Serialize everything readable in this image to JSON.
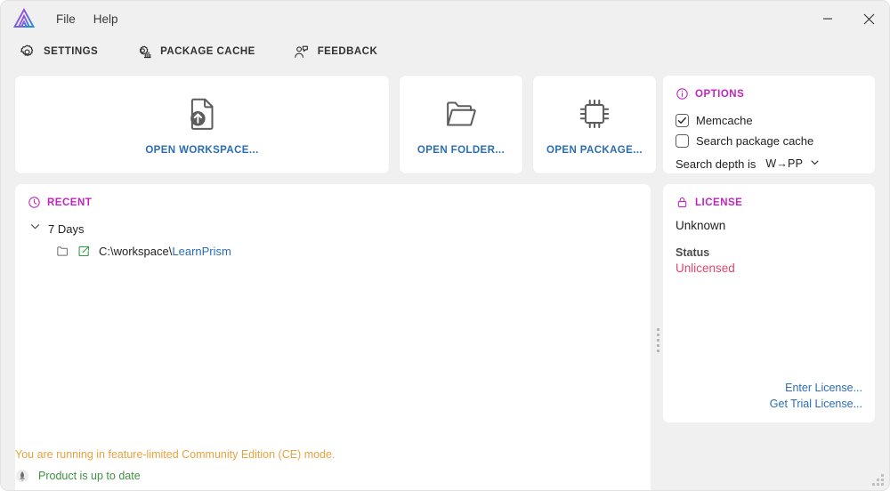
{
  "window": {
    "logo_name": "app-logo-triangle",
    "minimize_label": "Minimize",
    "close_label": "Close"
  },
  "menubar": {
    "items": [
      {
        "label": "File"
      },
      {
        "label": "Help"
      }
    ]
  },
  "commandbar": {
    "items": [
      {
        "label": "SETTINGS",
        "icon": "gear-icon"
      },
      {
        "label": "PACKAGE CACHE",
        "icon": "package-cache-icon"
      },
      {
        "label": "FEEDBACK",
        "icon": "feedback-icon"
      }
    ]
  },
  "cards": [
    {
      "label": "OPEN WORKSPACE...",
      "icon": "open-workspace-icon"
    },
    {
      "label": "OPEN FOLDER...",
      "icon": "open-folder-icon"
    },
    {
      "label": "OPEN PACKAGE...",
      "icon": "open-package-chip-icon"
    }
  ],
  "options": {
    "title": "OPTIONS",
    "icon": "info-icon",
    "memcache": {
      "label": "Memcache",
      "checked": true
    },
    "search_package_cache": {
      "label": "Search package cache",
      "checked": false
    },
    "search_depth": {
      "label": "Search depth is",
      "value": "W→PP"
    }
  },
  "license": {
    "title": "LICENSE",
    "icon": "lock-icon",
    "value": "Unknown",
    "status_label": "Status",
    "status_value": "Unlicensed",
    "enter_license_label": "Enter License...",
    "get_trial_label": "Get Trial License..."
  },
  "recent": {
    "title": "RECENT",
    "icon": "clock-icon",
    "group": {
      "label": "7 Days",
      "expanded": true
    },
    "items": [
      {
        "path_prefix": "C:\\workspace\\",
        "path_accent": "LearnPrism"
      }
    ]
  },
  "status": {
    "warning": "You are running in feature-limited Community Edition (CE) mode.",
    "update": "Product is up to date",
    "update_icon": "rocket-icon"
  },
  "colors": {
    "accent_link": "#2a6db5",
    "panel_title": "#c024c0",
    "warning": "#e8a33d",
    "ok": "#3f9142",
    "unlicensed": "#e0456a"
  }
}
